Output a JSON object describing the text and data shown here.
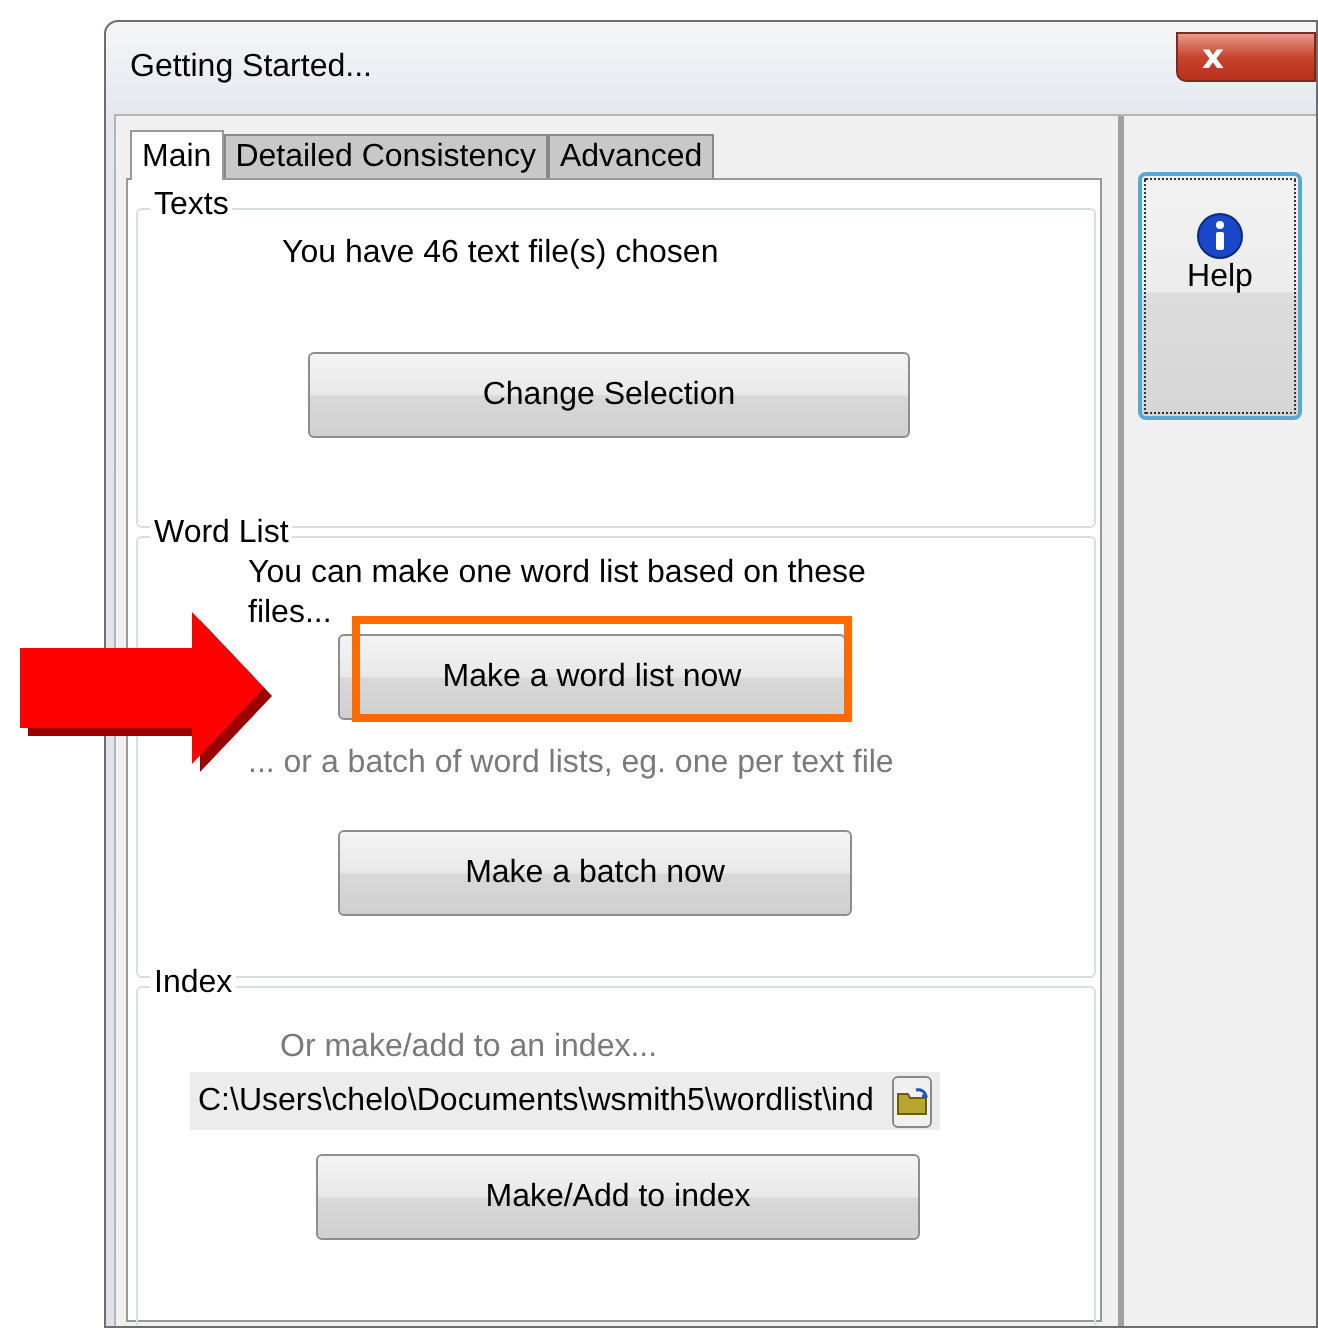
{
  "window": {
    "title": "Getting Started...",
    "close_label": "x"
  },
  "tabs": [
    {
      "label": "Main",
      "selected": true
    },
    {
      "label": "Detailed Consistency",
      "selected": false
    },
    {
      "label": "Advanced",
      "selected": false
    }
  ],
  "texts_group": {
    "title": "Texts",
    "info": "You have 46 text file(s) chosen",
    "button": "Change Selection"
  },
  "word_list_group": {
    "title": "Word List",
    "info": "You can make one word list based on these files...",
    "button": "Make a word list now",
    "button_highlighted": true,
    "arrow_pointer": true,
    "batch_info": "... or a batch of word lists, eg. one per text file",
    "batch_button": "Make a batch now"
  },
  "index_group": {
    "title": "Index",
    "info": "Or make/add to an index...",
    "path": "C:\\Users\\chelo\\Documents\\wsmith5\\wordlist\\ind",
    "button": "Make/Add to index"
  },
  "help_button": {
    "label": "Help"
  }
}
